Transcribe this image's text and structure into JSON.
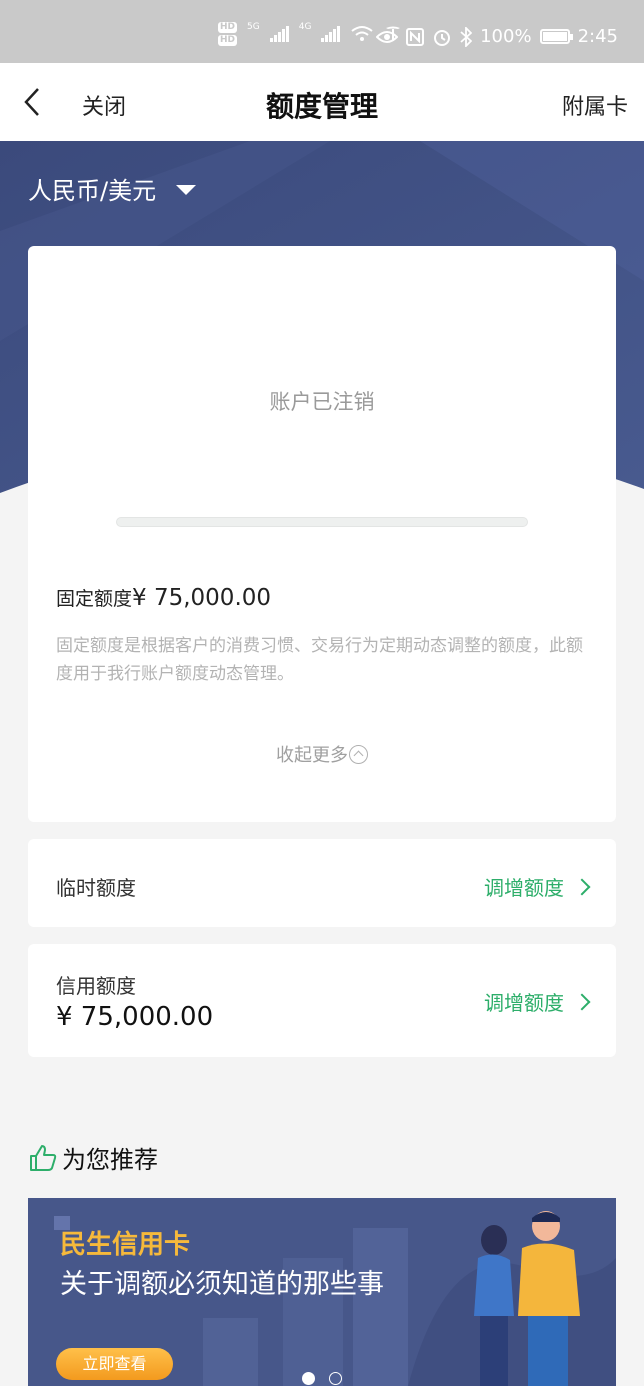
{
  "status_bar": {
    "hd1": "HD",
    "hd2": "HD",
    "net1": "5G",
    "net2": "4G",
    "battery": "100%",
    "time": "2:45"
  },
  "nav": {
    "close_label": "关闭",
    "title": "额度管理",
    "sub_card_label": "附属卡"
  },
  "currency": {
    "selected": "人民币/美元"
  },
  "main_card": {
    "account_status": "账户已注销",
    "fixed_label": "固定额度",
    "fixed_amount": "¥ 75,000.00",
    "description": "固定额度是根据客户的消费习惯、交易行为定期动态调整的额度，此额度用于我行账户额度动态管理。",
    "collapse_label": "收起更多"
  },
  "temp_limit": {
    "label": "临时额度",
    "action": "调增额度"
  },
  "credit_limit": {
    "label": "信用额度",
    "amount": "¥ 75,000.00",
    "action": "调增额度"
  },
  "recommend": {
    "title": "为您推荐"
  },
  "banner": {
    "brand": "民生信用卡",
    "headline": "关于调额必须知道的那些事",
    "button": "立即查看",
    "active_slide": 1,
    "slide_count": 2
  },
  "colors": {
    "accent_green": "#2dae6a",
    "hero_blue": "#3f4f80",
    "banner_orange": "#f6b93b"
  }
}
